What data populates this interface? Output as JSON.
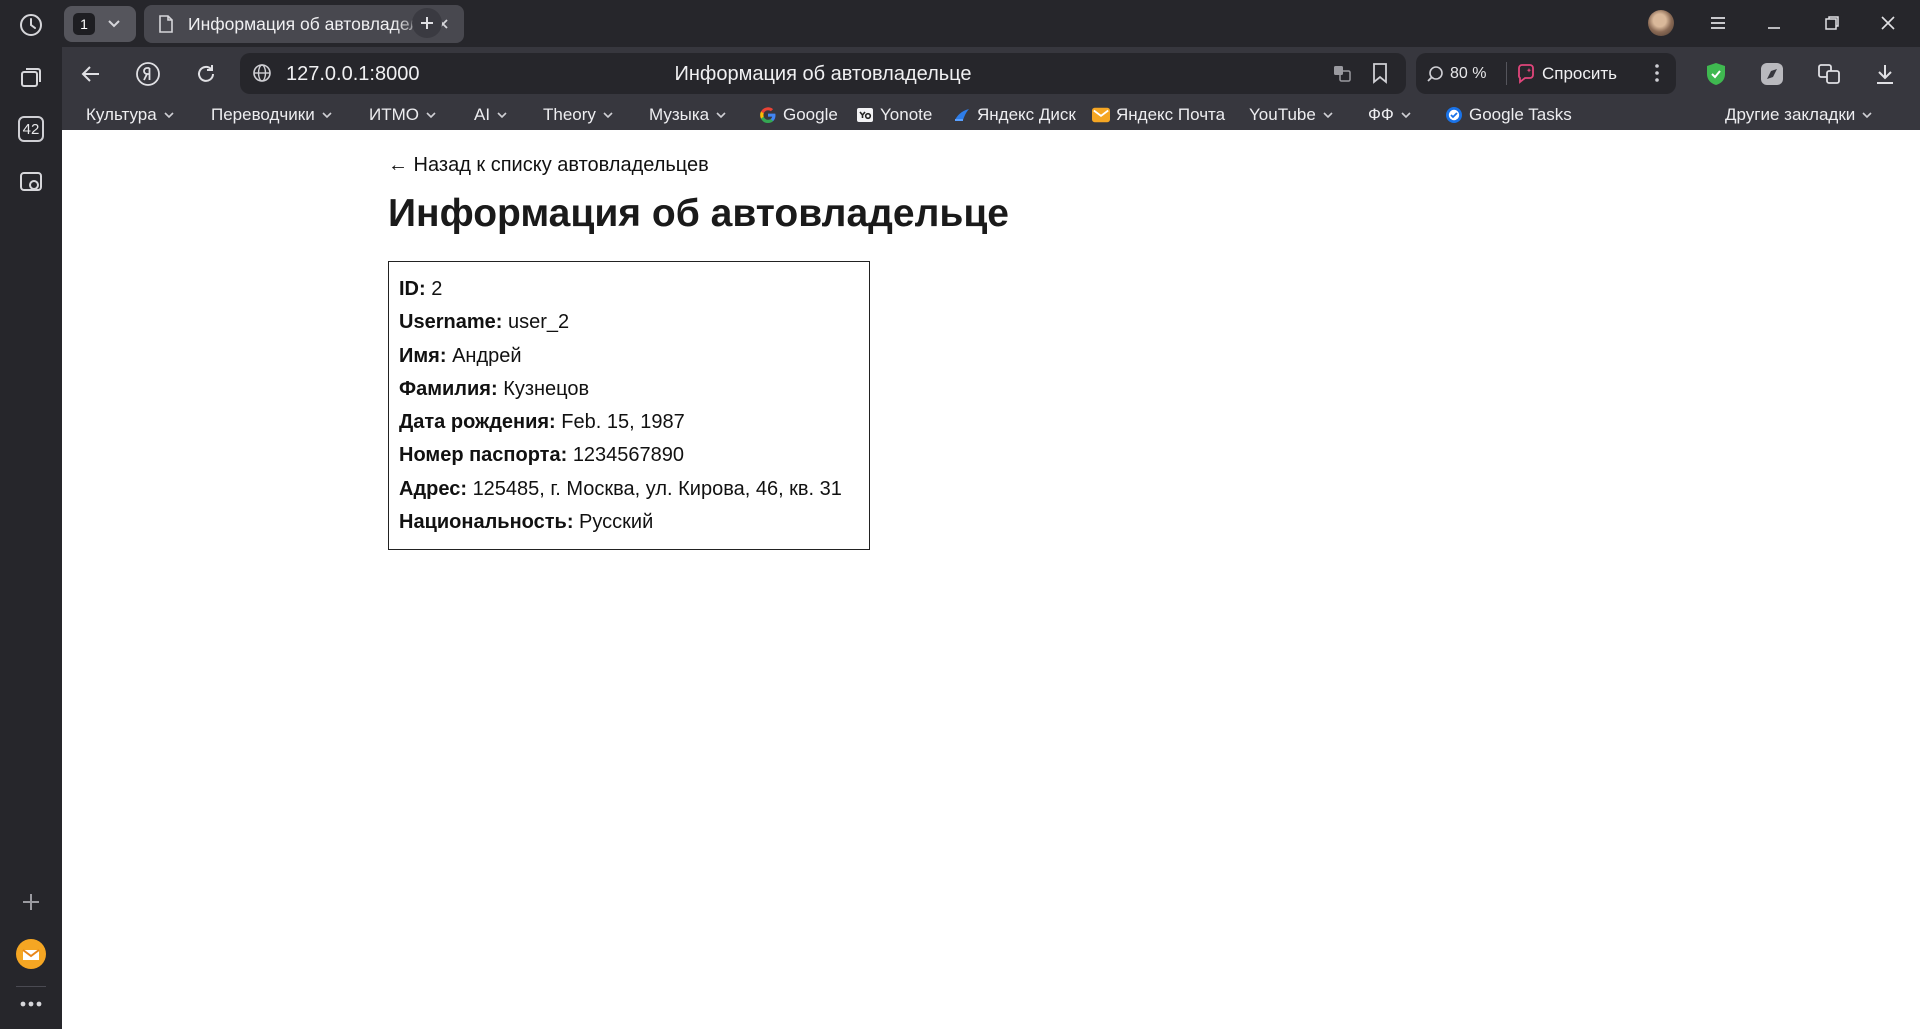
{
  "browser": {
    "tab_count": "1",
    "active_tab_title": "Информация об автовладельце",
    "url": "127.0.0.1:8000",
    "page_heading": "Информация об автовладельце",
    "zoom": "80 %",
    "ask_label": "Спросить",
    "sidebar_badge": "42"
  },
  "bookmarks": {
    "items": [
      {
        "label": "Культура"
      },
      {
        "label": "Переводчики"
      },
      {
        "label": "ИТМО"
      },
      {
        "label": "AI"
      },
      {
        "label": "Theory"
      },
      {
        "label": "Музыка"
      },
      {
        "label": "Google"
      },
      {
        "label": "Yonote"
      },
      {
        "label": "Яндекс Диск"
      },
      {
        "label": "Яндекс Почта"
      },
      {
        "label": "YouTube"
      },
      {
        "label": "ФФ"
      },
      {
        "label": "Google Tasks"
      },
      {
        "label": "Другие закладки"
      }
    ]
  },
  "page": {
    "back_link": "← Назад к списку автовладельцев",
    "title": "Информация об автовладельце",
    "fields": [
      {
        "label": "ID:",
        "value": "2"
      },
      {
        "label": "Username:",
        "value": "user_2"
      },
      {
        "label": "Имя:",
        "value": "Андрей"
      },
      {
        "label": "Фамилия:",
        "value": "Кузнецов"
      },
      {
        "label": "Дата рождения:",
        "value": "Feb. 15, 1987"
      },
      {
        "label": "Номер паспорта:",
        "value": "1234567890"
      },
      {
        "label": "Адрес:",
        "value": "125485, г. Москва, ул. Кирова, 46, кв. 31"
      },
      {
        "label": "Национальность:",
        "value": "Русский"
      }
    ]
  },
  "colors": {
    "browser_bg": "#26262b",
    "toolbar_bg": "#37373e",
    "page_bg": "#ffffff",
    "protect_green": "#3fb950",
    "ask_pink": "#e0457b"
  }
}
